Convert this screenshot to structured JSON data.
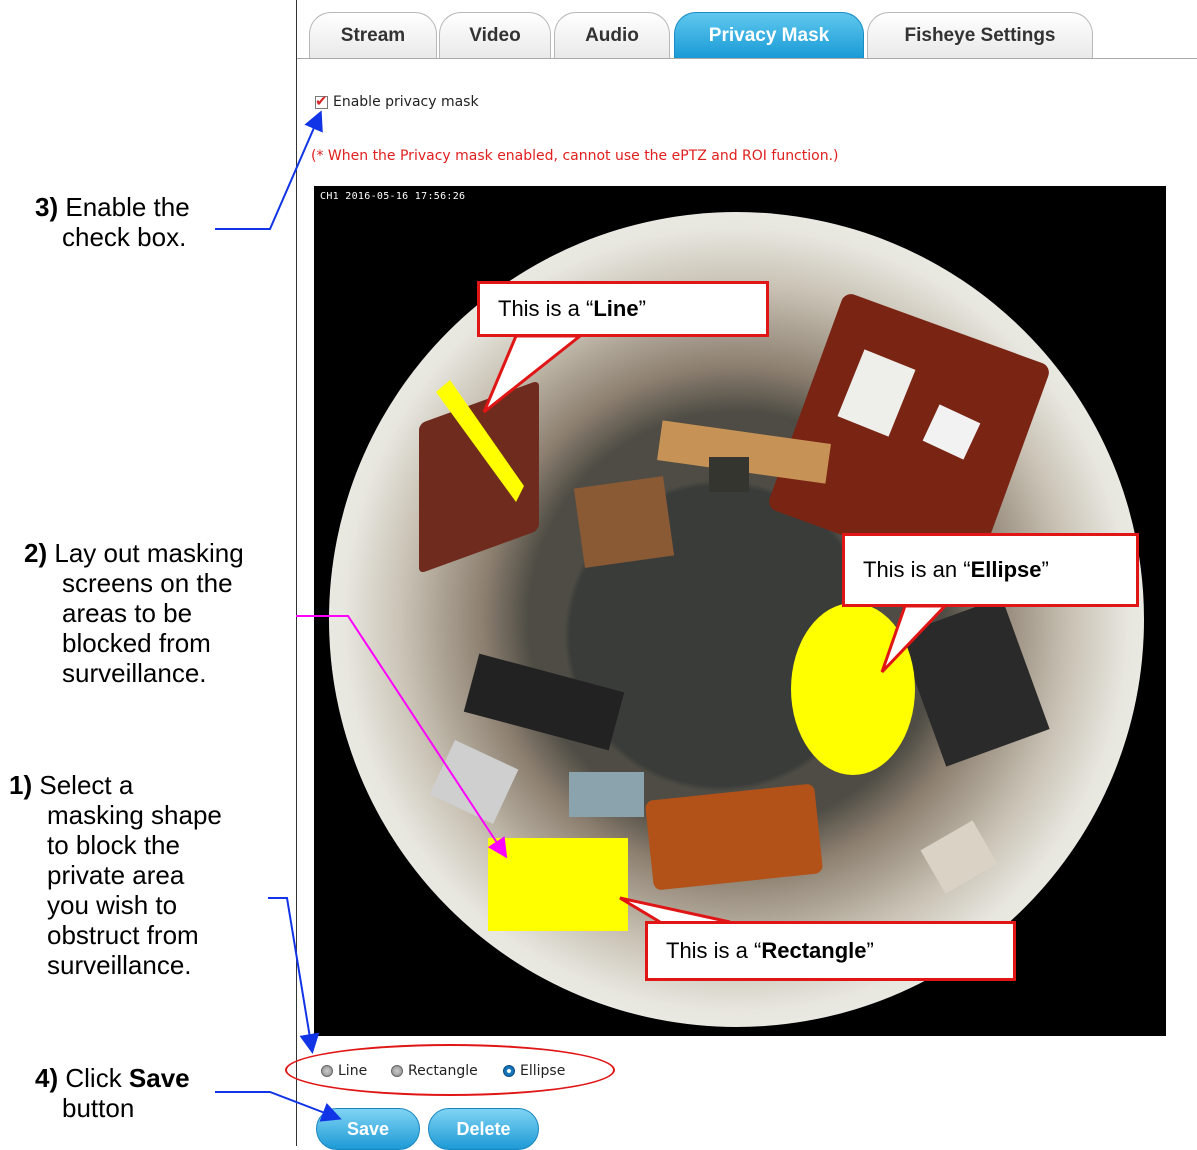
{
  "tabs": [
    {
      "label": "Stream",
      "active": false
    },
    {
      "label": "Video",
      "active": false
    },
    {
      "label": "Audio",
      "active": false
    },
    {
      "label": "Privacy Mask",
      "active": true
    },
    {
      "label": "Fisheye Settings",
      "active": false
    }
  ],
  "enable_checkbox": {
    "label": "Enable privacy mask",
    "checked": true
  },
  "warning_text": "(* When the Privacy mask enabled, cannot use the ePTZ and ROI function.)",
  "video": {
    "osd": "CH1 2016-05-16 17:56:26"
  },
  "shapes": {
    "options": [
      {
        "label": "Line",
        "selected": false
      },
      {
        "label": "Rectangle",
        "selected": false
      },
      {
        "label": "Ellipse",
        "selected": true
      }
    ]
  },
  "buttons": {
    "save": "Save",
    "delete": "Delete"
  },
  "callouts": {
    "line": {
      "prefix": "This is a “",
      "bold": "Line",
      "suffix": "”"
    },
    "ellipse": {
      "prefix": "This is an “",
      "bold": "Ellipse",
      "suffix": "”"
    },
    "rectangle": {
      "prefix": "This is a “",
      "bold": "Rectangle",
      "suffix": "”"
    }
  },
  "notes": {
    "step3": {
      "num": "3)",
      "line1": "Enable the",
      "line2": "check box."
    },
    "step2": {
      "num": "2)",
      "line1": "Lay out masking",
      "line2": "screens on the",
      "line3": "areas to be",
      "line4": "blocked from",
      "line5": "surveillance."
    },
    "step1": {
      "num": "1)",
      "line1": "Select a",
      "line2": "masking shape",
      "line3": "to block the",
      "line4": "private area",
      "line5": "you wish to",
      "line6": "obstruct from",
      "line7": "surveillance."
    },
    "step4": {
      "num": "4)",
      "line1a": "Click ",
      "line1b": "Save",
      "line2": "button"
    }
  },
  "colors": {
    "mask_yellow": "#ffff00",
    "callout_red": "#e01515",
    "arrow_blue": "#1034e6",
    "arrow_magenta": "#ff00ff",
    "tab_active": "#1a9bd6"
  }
}
